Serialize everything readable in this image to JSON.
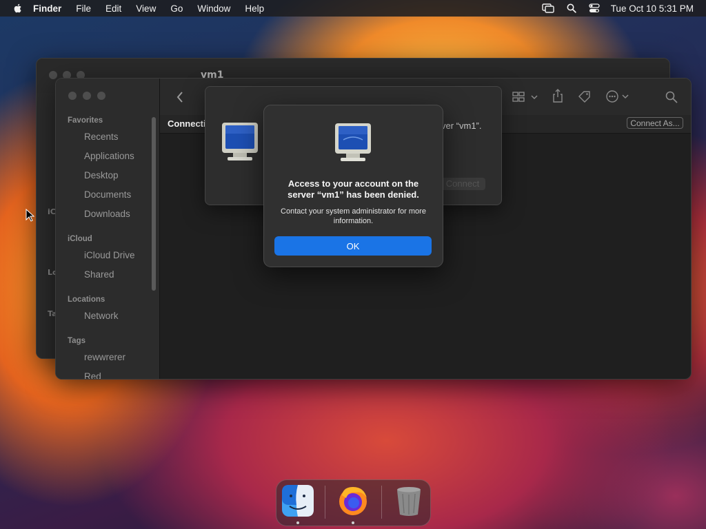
{
  "menubar": {
    "app_name": "Finder",
    "menus": [
      "File",
      "Edit",
      "View",
      "Go",
      "Window",
      "Help"
    ],
    "clock": "Tue Oct 10  5:31 PM",
    "icons": [
      "screen-mirroring-icon",
      "spotlight-search-icon",
      "control-center-icon"
    ]
  },
  "back_window": {
    "title": "vm1",
    "sidebar_labels": [
      "iC",
      "Loc",
      "Ta"
    ]
  },
  "finder": {
    "sidebar": {
      "favorites_label": "Favorites",
      "favorites": [
        "Recents",
        "Applications",
        "Desktop",
        "Documents",
        "Downloads"
      ],
      "icloud_label": "iCloud",
      "icloud": [
        "iCloud Drive",
        "Shared"
      ],
      "locations_label": "Locations",
      "locations": [
        "Network"
      ],
      "tags_label": "Tags",
      "tags": [
        "rewwrerer",
        "Red"
      ]
    },
    "path_title": "Connecti",
    "connect_as_label": "Connect As...",
    "toolbar_icons": [
      "back-icon",
      "forward-icon",
      "view-options-icon",
      "share-icon",
      "tag-icon",
      "more-icon",
      "search-icon"
    ]
  },
  "connect_sheet": {
    "status_text": "ver “vm1”.",
    "connect_label": "Connect"
  },
  "alert": {
    "headline": "Access to your account on the server “vm1” has been denied.",
    "message": "Contact your system administrator for more information.",
    "ok_label": "OK"
  },
  "dock": {
    "apps": [
      "Finder",
      "Firefox",
      "Trash"
    ]
  },
  "colors": {
    "accent": "#1a74e6",
    "window_bg": "#1f1f1f",
    "sidebar_bg": "#2c2c2c"
  }
}
